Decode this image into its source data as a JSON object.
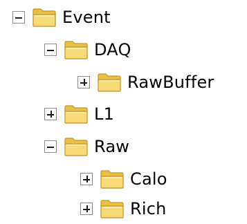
{
  "tree": {
    "nodes": [
      {
        "label": "Event",
        "state": "expanded",
        "icon": "folder-icon"
      },
      {
        "label": "DAQ",
        "state": "expanded",
        "icon": "folder-icon"
      },
      {
        "label": "RawBuffer",
        "state": "collapsed",
        "icon": "folder-icon"
      },
      {
        "label": "L1",
        "state": "collapsed",
        "icon": "folder-icon"
      },
      {
        "label": "Raw",
        "state": "expanded",
        "icon": "folder-icon"
      },
      {
        "label": "Calo",
        "state": "collapsed",
        "icon": "folder-icon"
      },
      {
        "label": "Rich",
        "state": "collapsed",
        "icon": "folder-icon"
      }
    ]
  },
  "colors": {
    "folder_body": "#f7d978",
    "folder_back": "#e9bf47",
    "folder_outline": "#c8952a",
    "toggle_border": "#8a8a8a",
    "text": "#000000"
  }
}
